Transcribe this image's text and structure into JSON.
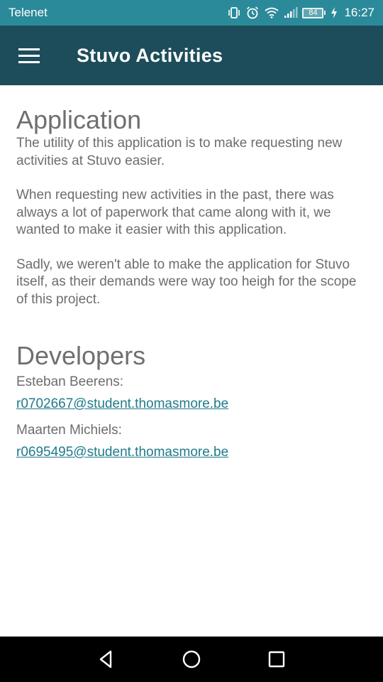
{
  "status_bar": {
    "carrier": "Telenet",
    "battery_level": "84",
    "time": "16:27",
    "icons": [
      "vibrate-icon",
      "alarm-icon",
      "wifi-icon",
      "signal-icon",
      "battery-icon",
      "charging-icon"
    ]
  },
  "app_bar": {
    "menu_icon": "hamburger-menu-icon",
    "title": "Stuvo Activities",
    "background_color": "#1d4d5a"
  },
  "content": {
    "application": {
      "heading": "Application",
      "paragraphs": [
        "The utility of this application is to make requesting new activities at Stuvo easier.",
        "When requesting new activities in the past, there was always a lot of paperwork that came along with it, we wanted to make it easier with this application.",
        "Sadly, we weren't able to make the application for Stuvo itself, as their demands were way too heigh for the scope of this project."
      ]
    },
    "developers": {
      "heading": "Developers",
      "people": [
        {
          "name": "Esteban Beerens:",
          "email": "r0702667@student.thomasmore.be"
        },
        {
          "name": "Maarten Michiels:",
          "email": "r0695495@student.thomasmore.be"
        }
      ]
    }
  },
  "nav_bar": {
    "buttons": [
      "back-icon",
      "home-icon",
      "recents-icon"
    ]
  },
  "colors": {
    "status_bar": "#2b8a9a",
    "app_bar": "#1d4d5a",
    "link": "#1f7a8a",
    "text": "#6d6d6d"
  }
}
